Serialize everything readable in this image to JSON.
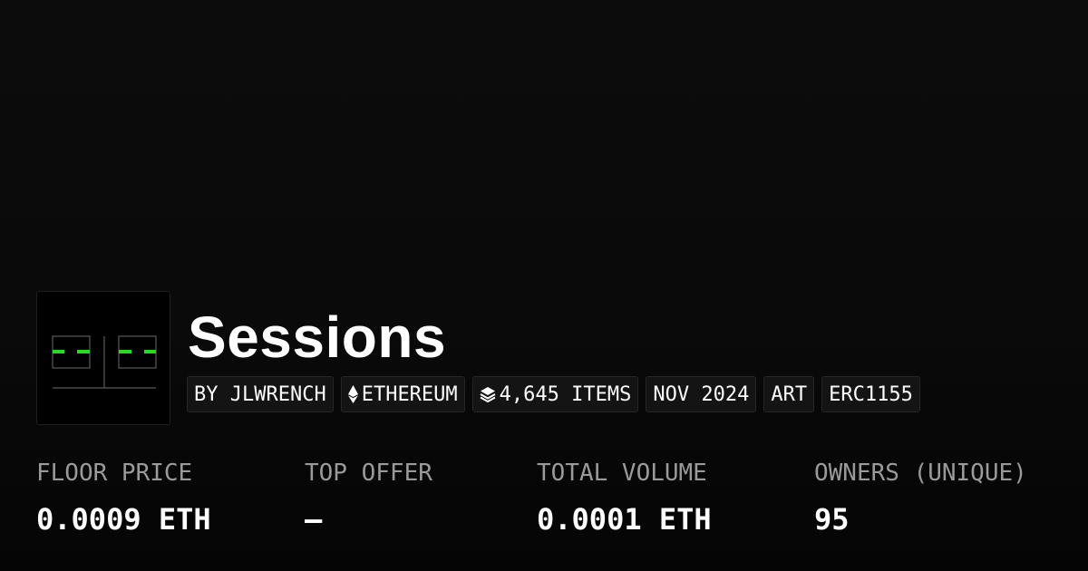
{
  "collection": {
    "name": "Sessions",
    "accent_color": "#22dd22",
    "thumbnail_icon": "sessions-artwork-icon"
  },
  "tags": {
    "creator": "BY JLWRENCH",
    "chain": "ETHEREUM",
    "chain_icon": "ethereum-icon",
    "items": "4,645 ITEMS",
    "items_icon": "layers-icon",
    "date": "NOV 2024",
    "category": "ART",
    "standard": "ERC1155"
  },
  "stats": [
    {
      "label": "FLOOR PRICE",
      "value": "0.0009 ETH"
    },
    {
      "label": "TOP OFFER",
      "value": "—"
    },
    {
      "label": "TOTAL VOLUME",
      "value": "0.0001 ETH"
    },
    {
      "label": "OWNERS (UNIQUE)",
      "value": "95"
    }
  ]
}
